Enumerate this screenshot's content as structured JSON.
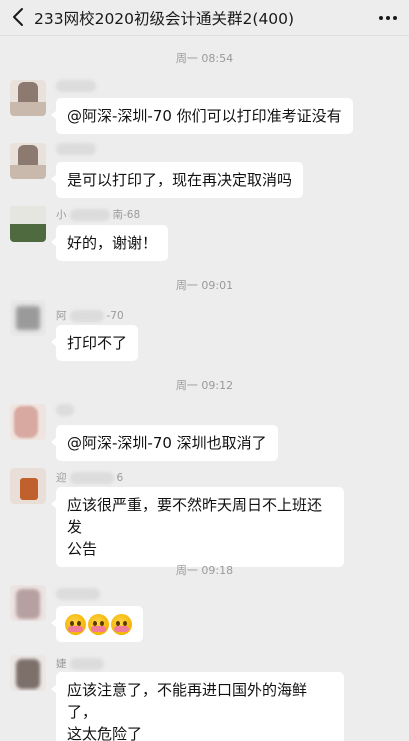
{
  "header": {
    "title": "233网校2020初级会计通关群2(400)",
    "back_icon": "chevron-left-icon",
    "more_icon": "more-dots-icon"
  },
  "timestamps": [
    "周一 08:54",
    "周一 09:01",
    "周一 09:12",
    "周一 09:18"
  ],
  "messages": [
    {
      "name": "",
      "text": "@阿深-深圳-70  你们可以打印准考证没有"
    },
    {
      "name": "",
      "text": "是可以打印了，现在再决定取消吗"
    },
    {
      "name_prefix": "小",
      "name_suffix": "南-68",
      "text": "好的，谢谢！"
    },
    {
      "name_prefix": "阿",
      "name_suffix": "-70",
      "text": "打印不了"
    },
    {
      "name": "",
      "text": "@阿深-深圳-70  深圳也取消了"
    },
    {
      "name_prefix": "迎",
      "name_suffix": "6",
      "line1": "应该很严重，要不然昨天周日不上班还发",
      "line2": "公告"
    },
    {
      "name": "",
      "text": ""
    },
    {
      "name_prefix": "婕",
      "name_suffix": "",
      "line1": "应该注意了，不能再进口国外的海鲜了，",
      "line2": "这太危险了"
    }
  ]
}
